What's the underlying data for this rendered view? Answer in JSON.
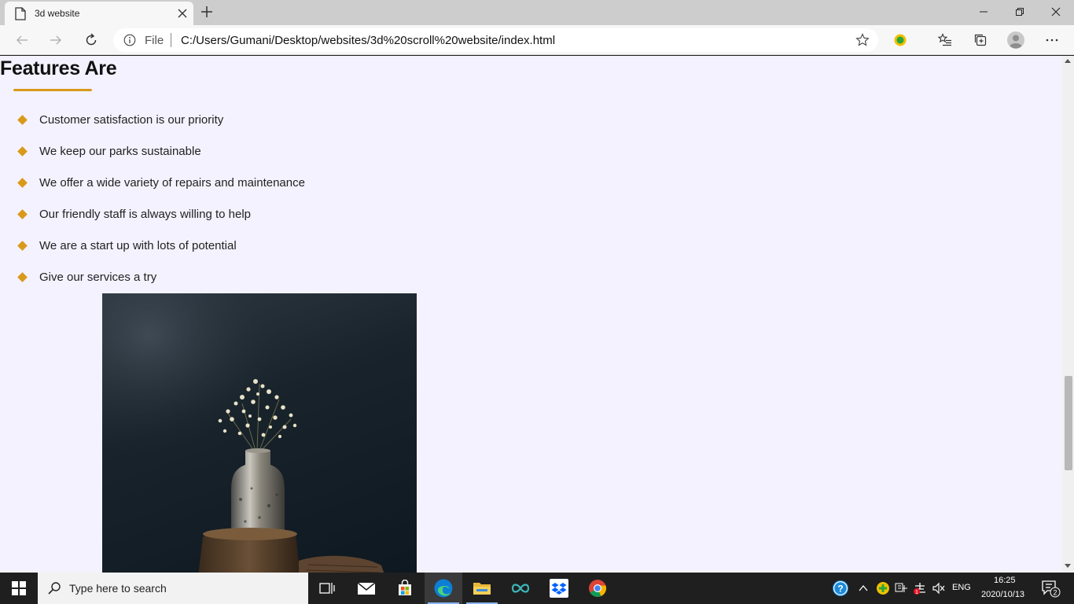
{
  "browser": {
    "tab_title": "3d website",
    "url_scheme": "File",
    "url": "C:/Users/Gumani/Desktop/websites/3d%20scroll%20website/index.html"
  },
  "page": {
    "heading": "Features Are",
    "accent_color": "#d99a1b",
    "background_color": "#f4f2fe",
    "features": [
      "Customer satisfaction is our priority",
      "We keep our parks sustainable",
      "We offer a wide variety of repairs and maintenance",
      "Our friendly staff is always willing to help",
      "We are a start up with lots of potential",
      "Give our services a try"
    ]
  },
  "taskbar": {
    "search_placeholder": "Type here to search",
    "language": "ENG",
    "time": "16:25",
    "date": "2020/10/13",
    "notification_count": "2"
  }
}
